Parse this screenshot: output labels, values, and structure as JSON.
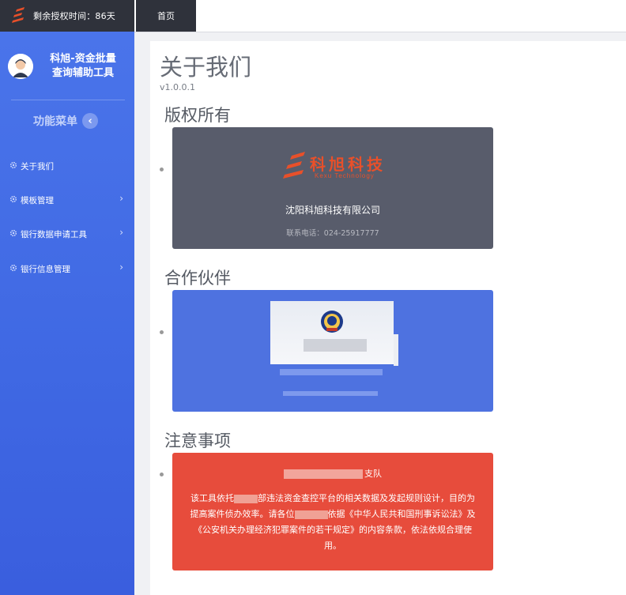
{
  "topbar": {
    "license_text": "剩余授权时间：86天",
    "tabs": [
      "首页"
    ]
  },
  "sidebar": {
    "app_name_line1": "科旭-资金批量",
    "app_name_line2": "查询辅助工具",
    "menu_header": "功能菜单",
    "items": [
      {
        "label": "关于我们",
        "has_children": false
      },
      {
        "label": "模板管理",
        "has_children": true
      },
      {
        "label": "银行数据申请工具",
        "has_children": true
      },
      {
        "label": "银行信息管理",
        "has_children": true
      }
    ]
  },
  "main": {
    "title": "关于我们",
    "version": "v1.0.0.1",
    "sections": [
      {
        "title": "版权所有"
      },
      {
        "title": "合作伙伴"
      },
      {
        "title": "注意事项"
      }
    ],
    "copyright_card": {
      "logo_text": "科旭科技",
      "logo_subtext": "Kexu Technology",
      "company": "沈阳科旭科技有限公司",
      "phone": "联系电话：024-25917777"
    },
    "notice_card": {
      "dept_suffix": "支队",
      "text_part1": "该工具依托",
      "text_part2": "部违法资金查控平台的相关数据及发起规则设计，目的为提高案件侦办效率。请各位",
      "text_part3": "依据《中华人民共和国刑事诉讼法》及《公安机关办理经济犯罪案件的若干规定》的内容条款，依法依规合理使用。"
    }
  },
  "colors": {
    "sidebar": "#4a74ea",
    "topbar_dark": "#2f323b",
    "card_dark": "#585c6b",
    "card_blue": "#4e72e0",
    "card_red": "#e74c3c",
    "brand_red": "#e8502a"
  }
}
